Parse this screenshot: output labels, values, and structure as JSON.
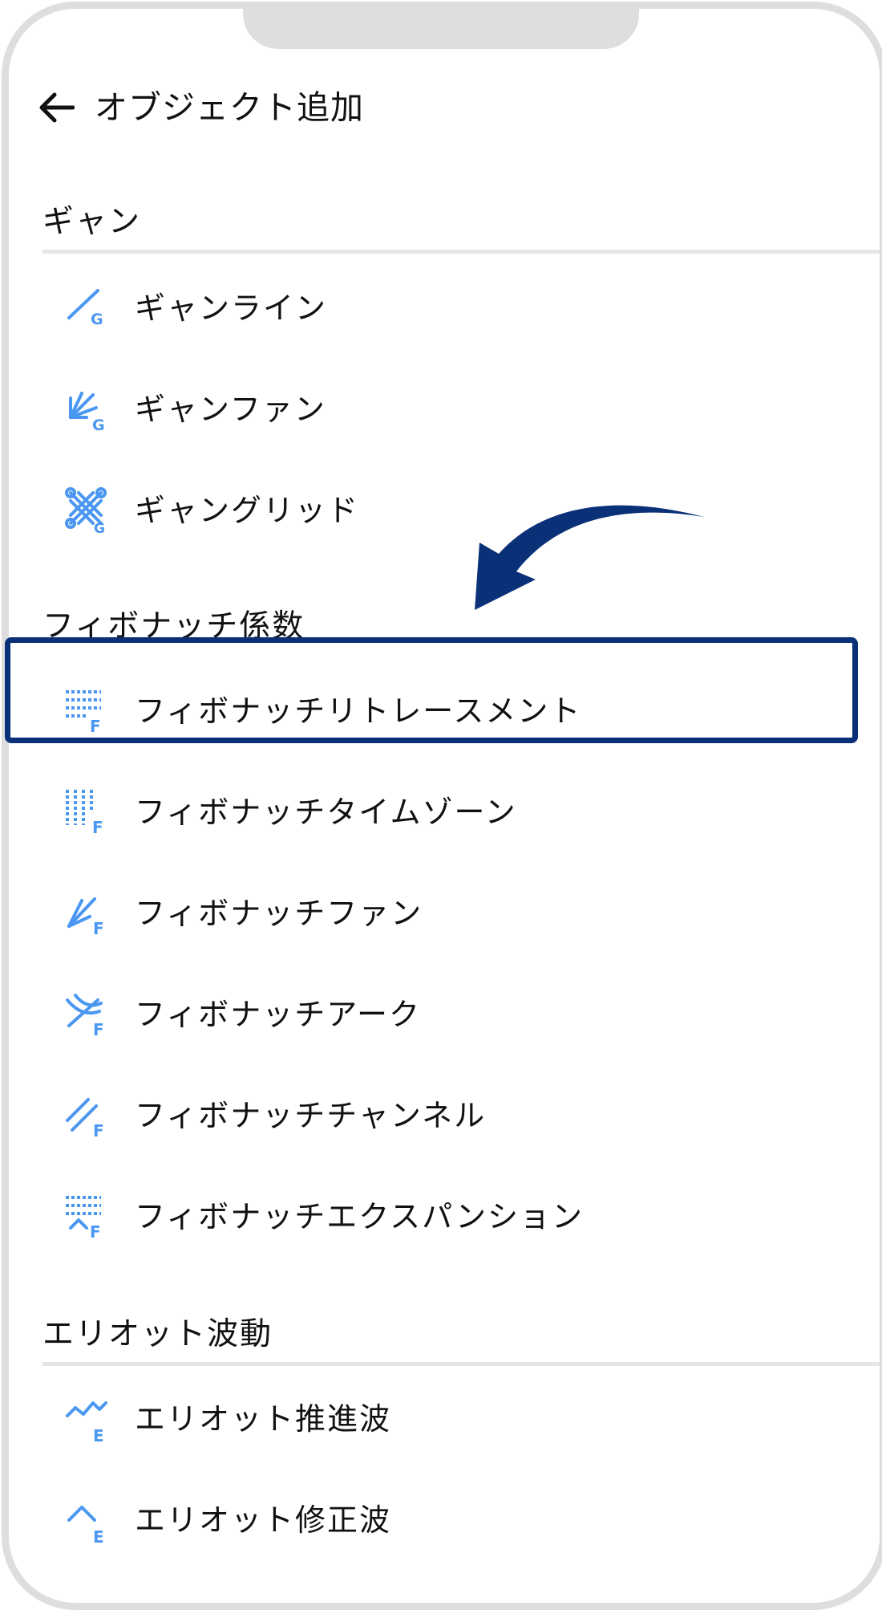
{
  "header": {
    "back_icon": "arrow-left-icon",
    "title": "オブジェクト追加"
  },
  "accent_color": "#4a97f2",
  "highlight_color": "#0a3178",
  "sections": [
    {
      "title": "ギャン",
      "items": [
        {
          "label": "ギャンライン",
          "icon": "gann-line-icon"
        },
        {
          "label": "ギャンファン",
          "icon": "gann-fan-icon"
        },
        {
          "label": "ギャングリッド",
          "icon": "gann-grid-icon"
        }
      ]
    },
    {
      "title": "フィボナッチ係数",
      "items": [
        {
          "label": "フィボナッチリトレースメント",
          "icon": "fib-retracement-icon",
          "highlighted": true
        },
        {
          "label": "フィボナッチタイムゾーン",
          "icon": "fib-time-zone-icon"
        },
        {
          "label": "フィボナッチファン",
          "icon": "fib-fan-icon"
        },
        {
          "label": "フィボナッチアーク",
          "icon": "fib-arc-icon"
        },
        {
          "label": "フィボナッチチャンネル",
          "icon": "fib-channel-icon"
        },
        {
          "label": "フィボナッチエクスパンション",
          "icon": "fib-expansion-icon"
        }
      ]
    },
    {
      "title": "エリオット波動",
      "items": [
        {
          "label": "エリオット推進波",
          "icon": "elliott-impulse-icon"
        },
        {
          "label": "エリオット修正波",
          "icon": "elliott-correction-icon"
        }
      ]
    }
  ]
}
